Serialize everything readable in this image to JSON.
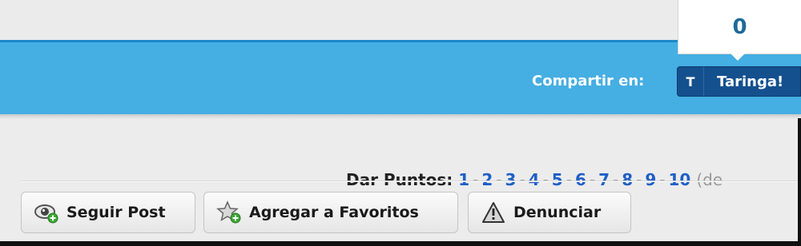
{
  "share": {
    "label": "Compartir en:",
    "network_icon_letter": "T",
    "network_label": "Taringa!",
    "count": "0"
  },
  "points": {
    "label": "Dar Puntos:",
    "values": [
      "1",
      "2",
      "3",
      "4",
      "5",
      "6",
      "7",
      "8",
      "9",
      "10"
    ],
    "tail": "(de"
  },
  "actions": {
    "follow_label": "Seguir Post",
    "favorite_label": "Agregar a Favoritos",
    "report_label": "Denunciar"
  },
  "colors": {
    "share_bar": "#45aee3",
    "taringa_button": "#14508e",
    "link_blue": "#1f5fc7"
  }
}
